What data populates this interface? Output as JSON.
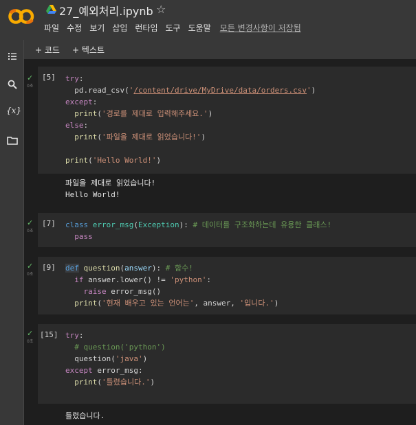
{
  "header": {
    "filename": "27_예외처리.ipynb",
    "menu": [
      "파일",
      "수정",
      "보기",
      "삽입",
      "런타임",
      "도구",
      "도움말"
    ],
    "save_status": "모든 변경사항이 저장됨"
  },
  "toolbar": {
    "add_code": "+ 코드",
    "add_text": "+ 텍스트"
  },
  "sidebar": {
    "icons": [
      "toc-icon",
      "search-icon",
      "variables-icon",
      "folder-icon"
    ],
    "variables_label": "{x}"
  },
  "cells": [
    {
      "prompt": "[5]",
      "exec_time": "0초",
      "lines": {
        "l1_kw": "try",
        "l1_rest": ":",
        "l2_pre": "  pd.read_csv(",
        "l2_str_open": "'",
        "l2_path": "/content/drive/MyDrive/data/orders.csv",
        "l2_str_close": "'",
        "l2_end": ")",
        "l3_kw": "except",
        "l3_rest": ":",
        "l4_fn": "print",
        "l4_str": "'경로를 제대로 입력해주세요.'",
        "l5_kw": "else",
        "l5_rest": ":",
        "l6_fn": "print",
        "l6_str": "'파일을 제대로 읽었습니다!'",
        "l7_fn": "print",
        "l7_str": "'Hello World!'"
      },
      "output": [
        "파일을 제대로 읽었습니다!",
        "Hello World!"
      ]
    },
    {
      "prompt": "[7]",
      "exec_time": "0초",
      "lines": {
        "l1_kw": "class",
        "l1_name": "error_msg",
        "l1_base": "Exception",
        "l1_comment": "# 데이터를 구조화하는데 유용한 클래스!",
        "l2_kw": "pass"
      }
    },
    {
      "prompt": "[9]",
      "exec_time": "0초",
      "lines": {
        "l1_kw": "def",
        "l1_name": "question",
        "l1_param": "answer",
        "l1_comment": "# 함수!",
        "l2_kw": "if",
        "l2_mid": " answer.lower() != ",
        "l2_str": "'python'",
        "l3_kw": "raise",
        "l3_rest": " error_msg()",
        "l4_fn": "print",
        "l4_str1": "'현재 배우고 있는 언어는'",
        "l4_mid": ", answer, ",
        "l4_str2": "'입니다.'"
      }
    },
    {
      "prompt": "[15]",
      "exec_time": "0초",
      "lines": {
        "l1_kw": "try",
        "l2_comment": "# question('python')",
        "l3_pre": "question(",
        "l3_str": "'java'",
        "l4_kw": "except",
        "l4_rest": " error_msg:",
        "l5_fn": "print",
        "l5_str": "'틀렸습니다.'"
      },
      "output": [
        "틀렸습니다."
      ]
    }
  ]
}
